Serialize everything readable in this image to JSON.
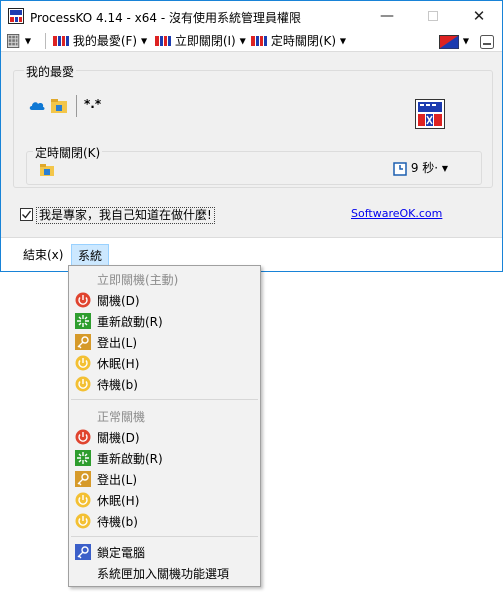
{
  "window": {
    "title": "ProcessKO 4.14 - x64 - 沒有使用系統管理員權限",
    "minimize_glyph": "—",
    "close_glyph": "✕"
  },
  "toolbar": {
    "favorites_label": "我的最愛(F)",
    "shutdown_now_label": "立即關閉(I)",
    "timed_shutdown_label": "定時關閉(K)"
  },
  "favorites_group": {
    "title": "我的最愛",
    "star_text": "*.*"
  },
  "timed_group": {
    "title": "定時關閉(K)",
    "timer_value": "9 秒·",
    "caret": "▼"
  },
  "expert": {
    "label": "我是專家，我自己知道在做什麼!",
    "checked": true
  },
  "link": {
    "text": "SoftwareOK.com"
  },
  "bottom": {
    "exit_label": "結束(x)",
    "system_label": "系統"
  },
  "menu": {
    "section1_header": "立即關機(主動)",
    "section1_items": [
      {
        "label": "關機(D)",
        "icon": "power-red-icon"
      },
      {
        "label": "重新啟動(R)",
        "icon": "restart-green-icon"
      },
      {
        "label": "登出(L)",
        "icon": "key-icon"
      },
      {
        "label": "休眠(H)",
        "icon": "power-yellow-icon"
      },
      {
        "label": "待機(b)",
        "icon": "power-yellow-icon"
      }
    ],
    "section2_header": "正常關機",
    "section2_items": [
      {
        "label": "關機(D)",
        "icon": "power-red-icon"
      },
      {
        "label": "重新啟動(R)",
        "icon": "restart-green-icon"
      },
      {
        "label": "登出(L)",
        "icon": "key-icon"
      },
      {
        "label": "休眠(H)",
        "icon": "power-yellow-icon"
      },
      {
        "label": "待機(b)",
        "icon": "power-yellow-icon"
      }
    ],
    "lock_label": "鎖定電腦",
    "tray_label": "系統匣加入關機功能選項"
  },
  "colors": {
    "accent_border": "#1883d7",
    "menu_highlight": "#cce8ff",
    "power_red": "#e0442f",
    "power_yellow": "#f3c033",
    "restart_green": "#2e9d2e"
  }
}
